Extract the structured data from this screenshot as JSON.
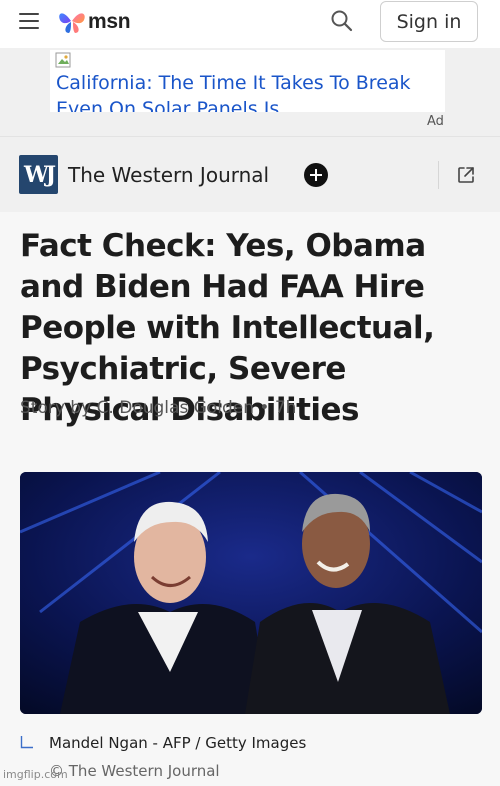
{
  "header": {
    "logo_text": "msn",
    "signin_label": "Sign in",
    "icons": [
      "hamburger-menu-icon",
      "msn-butterfly-logo",
      "search-icon"
    ]
  },
  "ad": {
    "headline": "California: The Time It Takes To Break Even On Solar Panels Is",
    "label": "Ad",
    "link_color": "#1a55c9"
  },
  "source": {
    "logo_initials": "WJ",
    "name": "The Western Journal",
    "logo_color": "#24466e",
    "icons": [
      "follow-plus-icon",
      "open-external-icon"
    ]
  },
  "article": {
    "headline": "Fact Check: Yes, Obama and Biden Had FAA Hire People with Intellectual, Psychiatric, Severe Physical Disabilities",
    "byline": "Story by C. Douglas Golden • 7h",
    "image_caption": "Mandel Ngan - AFP / Getty Images",
    "image_copyright": "© The Western Journal"
  },
  "watermark": "imgflip.com"
}
